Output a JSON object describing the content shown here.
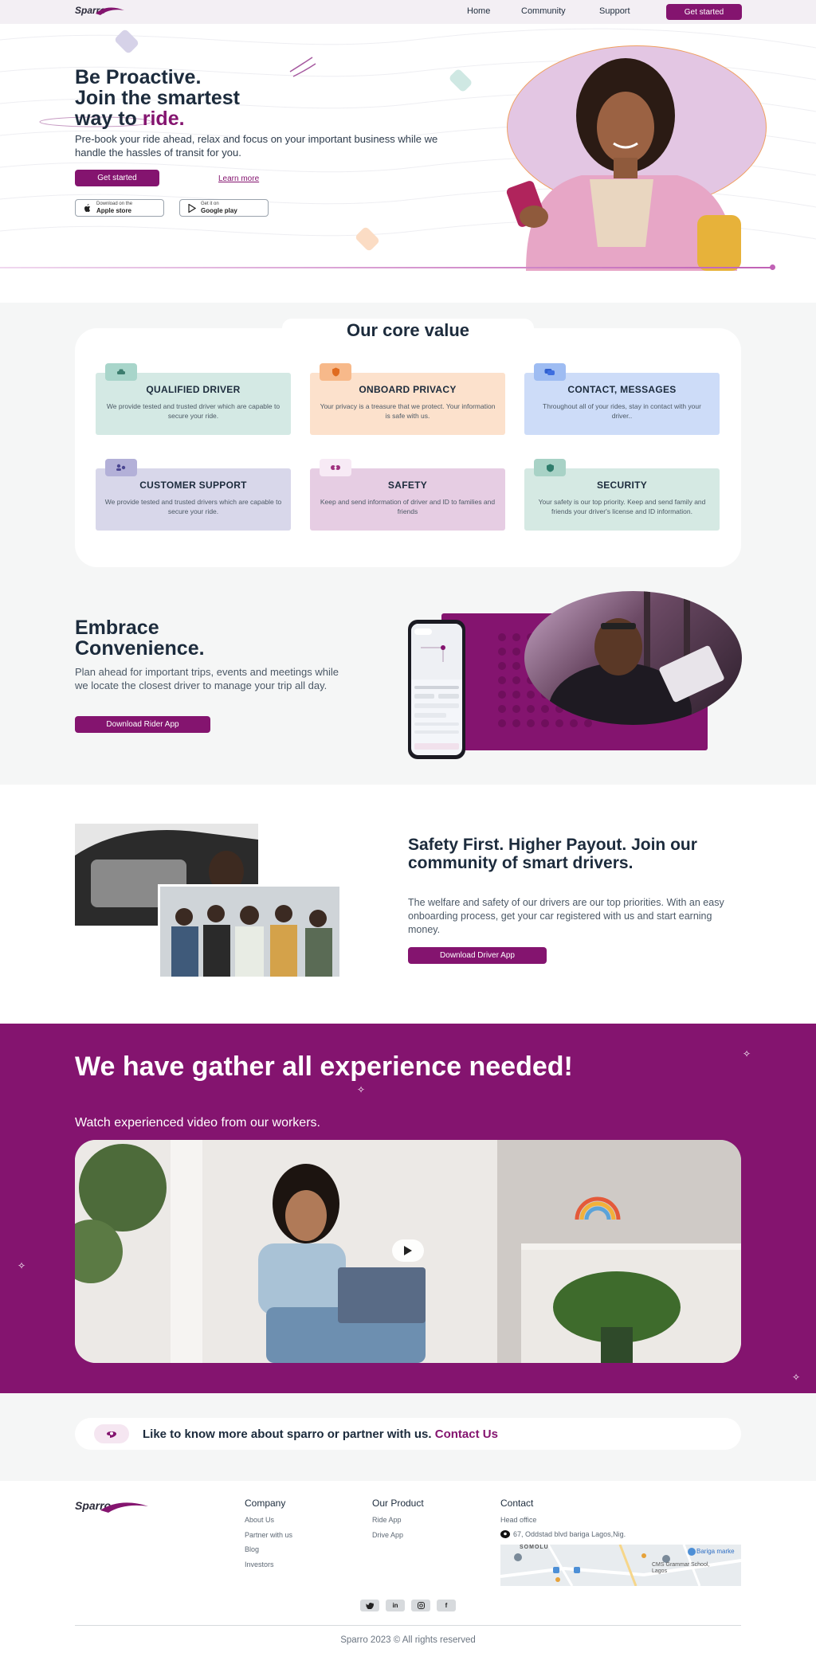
{
  "brand": {
    "name": "Sparro",
    "accent": "#84146f"
  },
  "nav": {
    "links": [
      "Home",
      "Community",
      "Support"
    ],
    "cta": "Get started"
  },
  "hero": {
    "title_line1": "Be Proactive.",
    "title_line2": "Join the smartest",
    "title_line3_prefix": "way to ",
    "title_line3_accent": "ride.",
    "subtitle": "Pre-book your ride ahead, relax and focus on your important business while we handle the hassles of transit for you.",
    "cta": "Get started",
    "learn_more": "Learn more",
    "stores": [
      {
        "small": "Download on the",
        "big": "Apple store",
        "icon": "apple-icon"
      },
      {
        "small": "Get it on",
        "big": "Google play",
        "icon": "google-play-icon"
      }
    ]
  },
  "core": {
    "title": "Our core value",
    "values": [
      {
        "title": "QUALIFIED DRIVER",
        "desc": "We provide tested and trusted driver which are capable to secure your ride.",
        "color": "#d4e9e4",
        "icon_color": "#a8d5ca",
        "icon": "car-icon"
      },
      {
        "title": "ONBOARD PRIVACY",
        "desc": "Your privacy is a treasure that we protect. Your information is safe with us.",
        "color": "#fce1cc",
        "icon_color": "#f7b98a",
        "icon": "shield-icon"
      },
      {
        "title": "CONTACT, MESSAGES",
        "desc": "Throughout all of your rides, stay in contact with your driver..",
        "color": "#cddcf8",
        "icon_color": "#9ebcf2",
        "icon": "chat-icon"
      },
      {
        "title": "CUSTOMER SUPPORT",
        "desc": "We provide tested and trusted drivers which are capable to secure your ride.",
        "color": "#d8d7ea",
        "icon_color": "#b3b0d8",
        "icon": "support-icon"
      },
      {
        "title": "SAFETY",
        "desc": "Keep and send information of driver and ID to families and friends",
        "color": "#e6cde3",
        "icon_color": "#d9aed4",
        "icon": "group-icon"
      },
      {
        "title": "SECURITY",
        "desc": "Your safety is our top priority. Keep and send family and friends your driver's license and ID information.",
        "color": "#d5e9e3",
        "icon_color": "#a8d2c6",
        "icon": "badge-icon"
      }
    ]
  },
  "embrace": {
    "title_line1": "Embrace",
    "title_line2": "Convenience.",
    "desc": "Plan ahead for important trips, events and meetings while we locate the closest driver to manage your trip all day.",
    "cta": "Download Rider App"
  },
  "drivers": {
    "title": "Safety First. Higher Payout. Join our community of smart drivers.",
    "desc": "The welfare and safety of our drivers are our top priorities. With an easy onboarding process, get your car registered with us and start earning money.",
    "cta": "Download Driver App"
  },
  "experience": {
    "title": "We have gather all experience needed!",
    "subtitle": "Watch experienced video from our workers."
  },
  "contact": {
    "text": "Like to know more about sparro or partner with us.",
    "link": "Contact Us"
  },
  "footer": {
    "company": {
      "title": "Company",
      "links": [
        "About Us",
        "Partner with us",
        "Blog",
        "Investors"
      ]
    },
    "product": {
      "title": "Our Product",
      "links": [
        "Ride App",
        "Drive App"
      ]
    },
    "contact": {
      "title": "Contact",
      "head_office": "Head office",
      "address": "67, Oddstad blvd bariga Lagos,Nig."
    },
    "map_labels": {
      "area": "SOMOLU",
      "place1": "Bariga marke",
      "place2": "CMS Grammar School, Lagos"
    },
    "socials": [
      "twitter-icon",
      "linkedin-icon",
      "instagram-icon",
      "facebook-icon"
    ],
    "copyright": "Sparro 2023 © All rights reserved"
  }
}
